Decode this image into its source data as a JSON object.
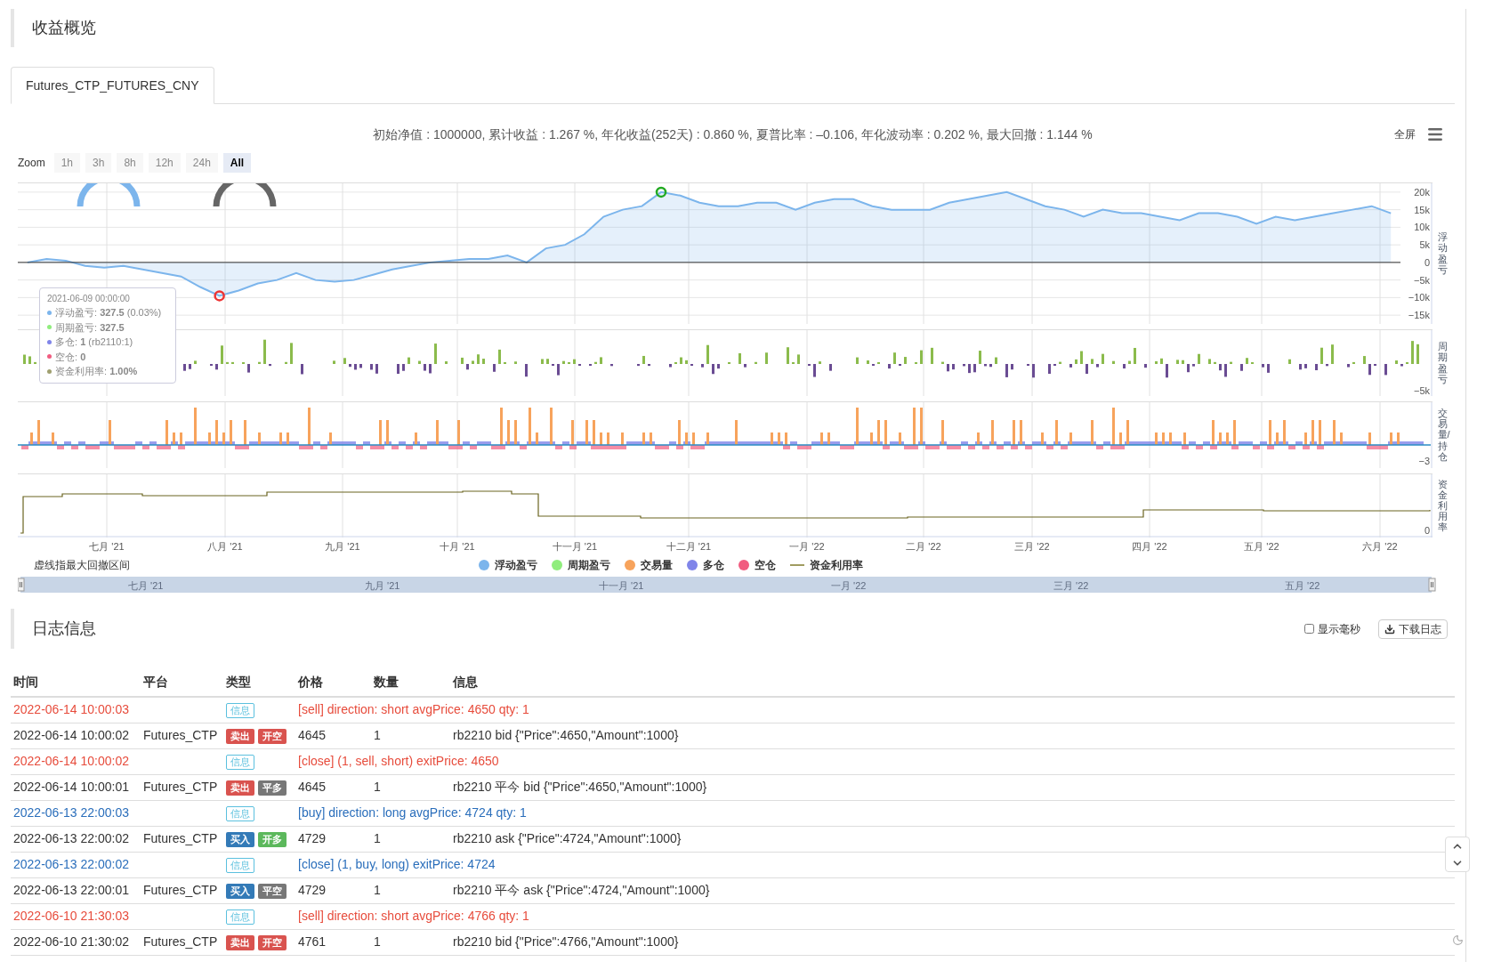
{
  "header": {
    "title": "收益概览"
  },
  "tabs": [
    {
      "label": "Futures_CTP_FUTURES_CNY",
      "selected": true
    }
  ],
  "summary": "初始净值 : 1000000, 累计收益 : 1.267 %, 年化收益(252天) : 0.860 %, 夏普比率 : –0.106, 年化波动率 : 0.202 %, 最大回撤 : 1.144 %",
  "fullscreen": "全屏",
  "zoom": {
    "label": "Zoom",
    "buttons": [
      {
        "label": "1h",
        "selected": false
      },
      {
        "label": "3h",
        "selected": false
      },
      {
        "label": "8h",
        "selected": false
      },
      {
        "label": "12h",
        "selected": false
      },
      {
        "label": "24h",
        "selected": false
      },
      {
        "label": "All",
        "selected": true
      }
    ]
  },
  "chart": {
    "axis_titles": [
      "周期盈亏",
      "交易量/持仓",
      "资金利用率"
    ],
    "months": [
      "七月 '21",
      "八月 '21",
      "九月 '21",
      "十月 '21",
      "十一月 '21",
      "十二月 '21",
      "一月 '22",
      "二月 '22",
      "三月 '22",
      "四月 '22",
      "五月 '22",
      "六月 '22"
    ],
    "chart_data": {
      "type": "area",
      "grid": true,
      "ylim": [
        -17500,
        22500
      ],
      "yticks": [
        {
          "value": 20000,
          "label": "20k"
        },
        {
          "value": 15000,
          "label": "15k"
        },
        {
          "value": 10000,
          "label": "10k"
        },
        {
          "value": 5000,
          "label": "5k"
        },
        {
          "value": 0,
          "label": "0"
        },
        {
          "value": -5000,
          "label": "−5k"
        },
        {
          "value": -10000,
          "label": "−10k"
        },
        {
          "value": -15000,
          "label": "−15k"
        }
      ],
      "series": [
        {
          "name": "浮动盈亏",
          "color": "#7cb5ec",
          "values": [
            0,
            1000,
            500,
            -1000,
            -1500,
            -1000,
            -2000,
            -3000,
            -4000,
            -7000,
            -9500,
            -8000,
            -6000,
            -5000,
            -3000,
            -5000,
            -5500,
            -5000,
            -3500,
            -2000,
            -1000,
            0,
            500,
            1000,
            1000,
            2000,
            0,
            4000,
            5000,
            8000,
            13000,
            15000,
            16000,
            20000,
            19000,
            17000,
            16000,
            16000,
            17000,
            17000,
            15000,
            17000,
            18000,
            18000,
            16000,
            15000,
            15000,
            15000,
            17000,
            18000,
            19000,
            20000,
            18000,
            16000,
            15000,
            13000,
            15000,
            14000,
            14000,
            13000,
            12000,
            14000,
            14000,
            13000,
            11000,
            13000,
            12000,
            13000,
            14000,
            15000,
            16000,
            14000
          ]
        }
      ]
    },
    "panel_ticks": [
      "−5k",
      "−3",
      "0"
    ],
    "tooltip": {
      "time": "2021-06-09 00:00:00",
      "lines": [
        {
          "label": "浮动盈亏: ",
          "value": "327.5",
          "extra": " (0.03%)",
          "color": "#7cb5ec"
        },
        {
          "label": "周期盈亏: ",
          "value": "327.5",
          "color": "#90ed7d"
        },
        {
          "label": "多仓: ",
          "value": "1",
          "extra": " (rb2110:1)",
          "color": "#8085e9"
        },
        {
          "label": "空仓: ",
          "value": "0",
          "color": "#f15c80"
        },
        {
          "label": "资金利用率: ",
          "value": "1.00%",
          "color": "#a0a070"
        }
      ]
    },
    "note": "虚线指最大回撤区间",
    "legend": [
      {
        "label": "浮动盈亏",
        "color": "#7cb5ec",
        "kind": "dot"
      },
      {
        "label": "周期盈亏",
        "color": "#90ed7d",
        "kind": "dot"
      },
      {
        "label": "交易量",
        "color": "#f7a35c",
        "kind": "dot"
      },
      {
        "label": "多仓",
        "color": "#8085e9",
        "kind": "dot"
      },
      {
        "label": "空仓",
        "color": "#f15c80",
        "kind": "dot"
      },
      {
        "label": "资金利用率",
        "color": "#a09c60",
        "kind": "line"
      }
    ],
    "navigator_labels": [
      "七月 '21",
      "九月 '21",
      "十一月 '21",
      "一月 '22",
      "三月 '22",
      "五月 '22"
    ]
  },
  "log": {
    "title": "日志信息",
    "show_ms": {
      "label": "显示毫秒",
      "checked": false
    },
    "download": "下载日志",
    "columns": [
      "时间",
      "平台",
      "类型",
      "价格",
      "数量",
      "信息"
    ],
    "rows": [
      {
        "kind": "info",
        "color": "#e74c3c",
        "time": "2022-06-14 10:00:03",
        "badge": "信息",
        "message": "[sell] direction: short avgPrice: 4650 qty: 1"
      },
      {
        "kind": "trade",
        "time": "2022-06-14 10:00:02",
        "platform": "Futures_CTP",
        "badges": [
          {
            "label": "卖出",
            "color": "#d9534f"
          },
          {
            "label": "开空",
            "color": "#d9534f"
          }
        ],
        "price": "4645",
        "amount": "1",
        "message": "rb2210 bid {\"Price\":4650,\"Amount\":1000}"
      },
      {
        "kind": "info",
        "color": "#e74c3c",
        "time": "2022-06-14 10:00:02",
        "badge": "信息",
        "message": "[close] (1, sell, short) exitPrice: 4650"
      },
      {
        "kind": "trade",
        "time": "2022-06-14 10:00:01",
        "platform": "Futures_CTP",
        "badges": [
          {
            "label": "卖出",
            "color": "#d9534f"
          },
          {
            "label": "平多",
            "color": "#777777"
          }
        ],
        "price": "4645",
        "amount": "1",
        "message": "rb2210 平今 bid {\"Price\":4650,\"Amount\":1000}"
      },
      {
        "kind": "info",
        "color": "#2a6ebb",
        "time": "2022-06-13 22:00:03",
        "badge": "信息",
        "message": "[buy] direction: long avgPrice: 4724 qty: 1"
      },
      {
        "kind": "trade",
        "time": "2022-06-13 22:00:02",
        "platform": "Futures_CTP",
        "badges": [
          {
            "label": "买入",
            "color": "#337ab7"
          },
          {
            "label": "开多",
            "color": "#5cb85c"
          }
        ],
        "price": "4729",
        "amount": "1",
        "message": "rb2210 ask {\"Price\":4724,\"Amount\":1000}"
      },
      {
        "kind": "info",
        "color": "#2a6ebb",
        "time": "2022-06-13 22:00:02",
        "badge": "信息",
        "message": "[close] (1, buy, long) exitPrice: 4724"
      },
      {
        "kind": "trade",
        "time": "2022-06-13 22:00:01",
        "platform": "Futures_CTP",
        "badges": [
          {
            "label": "买入",
            "color": "#337ab7"
          },
          {
            "label": "平空",
            "color": "#777777"
          }
        ],
        "price": "4729",
        "amount": "1",
        "message": "rb2210 平今 ask {\"Price\":4724,\"Amount\":1000}"
      },
      {
        "kind": "info",
        "color": "#e74c3c",
        "time": "2022-06-10 21:30:03",
        "badge": "信息",
        "message": "[sell] direction: short avgPrice: 4766 qty: 1"
      },
      {
        "kind": "trade",
        "time": "2022-06-10 21:30:02",
        "platform": "Futures_CTP",
        "badges": [
          {
            "label": "卖出",
            "color": "#d9534f"
          },
          {
            "label": "开空",
            "color": "#d9534f"
          }
        ],
        "price": "4761",
        "amount": "1",
        "message": "rb2210 bid {\"Price\":4766,\"Amount\":1000}"
      }
    ]
  }
}
